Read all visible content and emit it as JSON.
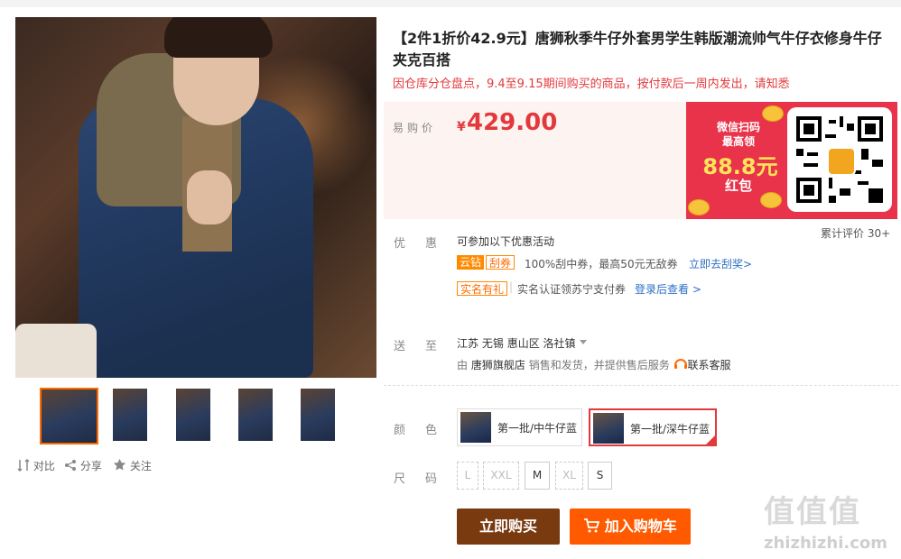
{
  "product": {
    "title": "【2件1折价42.9元】唐狮秋季牛仔外套男学生韩版潮流帅气牛仔衣修身牛仔夹克百搭",
    "notice": "因仓库分仓盘点，9.4至9.15期间购买的商品，按付款后一周内发出，请知悉",
    "price_label": "易购价",
    "price_symbol": "¥",
    "price": "429.00"
  },
  "promo_banner": {
    "line1": "微信扫码",
    "line2": "最高领",
    "amount": "88.8元",
    "line3": "红包"
  },
  "reviews": "累计评价 30+",
  "discount": {
    "label": "优惠",
    "intro": "可参加以下优惠活动",
    "tag1": "云钻",
    "tag2": "刮券",
    "coupon_text": "100%刮中券，最高50元无敌券",
    "coupon_link": "立即去刮奖>",
    "tag3": "实名有礼",
    "realname_text": "实名认证领苏宁支付券",
    "realname_link": "登录后查看 >"
  },
  "delivery": {
    "label": "送至",
    "province": "江苏",
    "city": "无锡",
    "district": "惠山区",
    "town": "洛社镇",
    "seller_prefix": "由",
    "seller": "唐狮旗舰店",
    "seller_suffix": "销售和发货，并提供售后服务",
    "service": "联系客服"
  },
  "color": {
    "label": "颜色",
    "options": [
      "第一批/中牛仔蓝",
      "第一批/深牛仔蓝"
    ],
    "selected_index": 1
  },
  "size": {
    "label": "尺码",
    "options": [
      "L",
      "XXL",
      "M",
      "XL",
      "S"
    ],
    "available": [
      false,
      false,
      true,
      false,
      true
    ]
  },
  "buttons": {
    "buy": "立即购买",
    "cart": "加入购物车"
  },
  "actions": {
    "compare": "对比",
    "share": "分享",
    "follow": "关注"
  },
  "watermark": {
    "cn": "值值值",
    "url": "zhizhizhi.com"
  },
  "colors": {
    "price_red": "#e4393c",
    "buy_brown": "#7a3a10",
    "cart_orange": "#ff5a00",
    "link_blue": "#2d6fc4"
  }
}
